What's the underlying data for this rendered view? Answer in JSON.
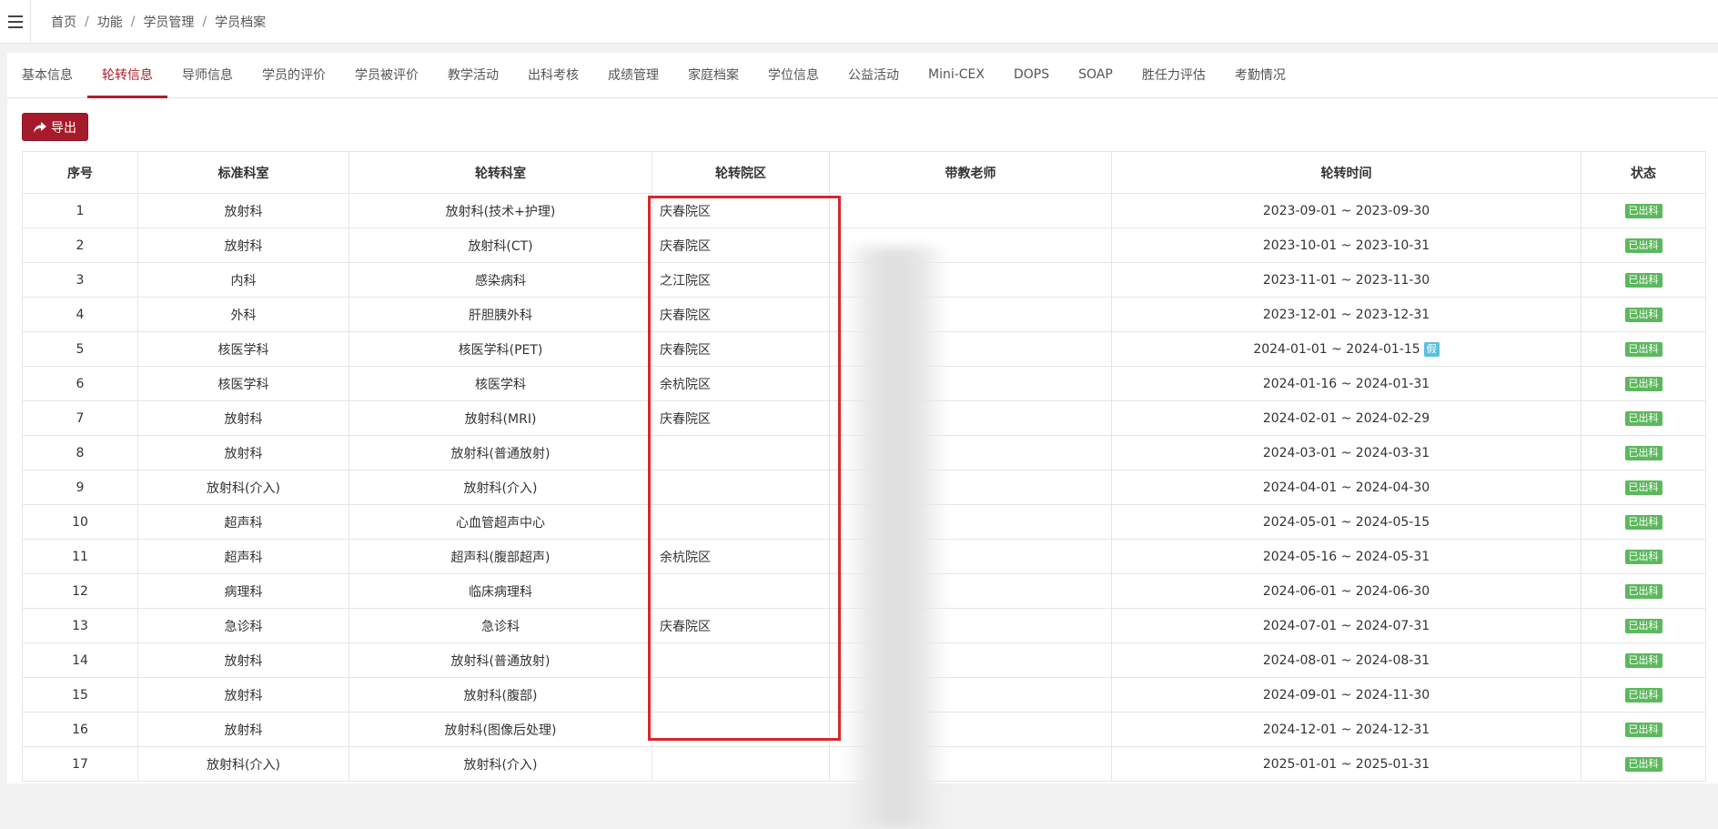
{
  "breadcrumb": [
    "首页",
    "功能",
    "学员管理",
    "学员档案"
  ],
  "tabs": [
    {
      "label": "基本信息",
      "active": false
    },
    {
      "label": "轮转信息",
      "active": true
    },
    {
      "label": "导师信息",
      "active": false
    },
    {
      "label": "学员的评价",
      "active": false
    },
    {
      "label": "学员被评价",
      "active": false
    },
    {
      "label": "教学活动",
      "active": false
    },
    {
      "label": "出科考核",
      "active": false
    },
    {
      "label": "成绩管理",
      "active": false
    },
    {
      "label": "家庭档案",
      "active": false
    },
    {
      "label": "学位信息",
      "active": false
    },
    {
      "label": "公益活动",
      "active": false
    },
    {
      "label": "Mini-CEX",
      "active": false
    },
    {
      "label": "DOPS",
      "active": false
    },
    {
      "label": "SOAP",
      "active": false
    },
    {
      "label": "胜任力评估",
      "active": false
    },
    {
      "label": "考勤情况",
      "active": false
    }
  ],
  "toolbar": {
    "export_label": "导出"
  },
  "table": {
    "headers": [
      "序号",
      "标准科室",
      "轮转科室",
      "轮转院区",
      "带教老师",
      "轮转时间",
      "状态"
    ],
    "rows": [
      {
        "no": "1",
        "std_dept": "放射科",
        "dept": "放射科(技术+护理)",
        "campus": "庆春院区",
        "teacher": "",
        "time": "2023-09-01 ~ 2023-09-30",
        "leave": "",
        "status": "已出科"
      },
      {
        "no": "2",
        "std_dept": "放射科",
        "dept": "放射科(CT)",
        "campus": "庆春院区",
        "teacher": "",
        "time": "2023-10-01 ~ 2023-10-31",
        "leave": "",
        "status": "已出科"
      },
      {
        "no": "3",
        "std_dept": "内科",
        "dept": "感染病科",
        "campus": "之江院区",
        "teacher": "",
        "time": "2023-11-01 ~ 2023-11-30",
        "leave": "",
        "status": "已出科"
      },
      {
        "no": "4",
        "std_dept": "外科",
        "dept": "肝胆胰外科",
        "campus": "庆春院区",
        "teacher": "",
        "time": "2023-12-01 ~ 2023-12-31",
        "leave": "",
        "status": "已出科"
      },
      {
        "no": "5",
        "std_dept": "核医学科",
        "dept": "核医学科(PET)",
        "campus": "庆春院区",
        "teacher": "",
        "time": "2024-01-01 ~ 2024-01-15",
        "leave": "假",
        "status": "已出科"
      },
      {
        "no": "6",
        "std_dept": "核医学科",
        "dept": "核医学科",
        "campus": "余杭院区",
        "teacher": "",
        "time": "2024-01-16 ~ 2024-01-31",
        "leave": "",
        "status": "已出科"
      },
      {
        "no": "7",
        "std_dept": "放射科",
        "dept": "放射科(MRI)",
        "campus": "庆春院区",
        "teacher": "",
        "time": "2024-02-01 ~ 2024-02-29",
        "leave": "",
        "status": "已出科"
      },
      {
        "no": "8",
        "std_dept": "放射科",
        "dept": "放射科(普通放射)",
        "campus": "",
        "teacher": "",
        "time": "2024-03-01 ~ 2024-03-31",
        "leave": "",
        "status": "已出科"
      },
      {
        "no": "9",
        "std_dept": "放射科(介入)",
        "dept": "放射科(介入)",
        "campus": "",
        "teacher": "",
        "time": "2024-04-01 ~ 2024-04-30",
        "leave": "",
        "status": "已出科"
      },
      {
        "no": "10",
        "std_dept": "超声科",
        "dept": "心血管超声中心",
        "campus": "",
        "teacher": "",
        "time": "2024-05-01 ~ 2024-05-15",
        "leave": "",
        "status": "已出科"
      },
      {
        "no": "11",
        "std_dept": "超声科",
        "dept": "超声科(腹部超声)",
        "campus": "余杭院区",
        "teacher": "",
        "time": "2024-05-16 ~ 2024-05-31",
        "leave": "",
        "status": "已出科"
      },
      {
        "no": "12",
        "std_dept": "病理科",
        "dept": "临床病理科",
        "campus": "",
        "teacher": "",
        "time": "2024-06-01 ~ 2024-06-30",
        "leave": "",
        "status": "已出科"
      },
      {
        "no": "13",
        "std_dept": "急诊科",
        "dept": "急诊科",
        "campus": "庆春院区",
        "teacher": "",
        "time": "2024-07-01 ~ 2024-07-31",
        "leave": "",
        "status": "已出科"
      },
      {
        "no": "14",
        "std_dept": "放射科",
        "dept": "放射科(普通放射)",
        "campus": "",
        "teacher": "",
        "time": "2024-08-01 ~ 2024-08-31",
        "leave": "",
        "status": "已出科"
      },
      {
        "no": "15",
        "std_dept": "放射科",
        "dept": "放射科(腹部)",
        "campus": "",
        "teacher": "",
        "time": "2024-09-01 ~ 2024-11-30",
        "leave": "",
        "status": "已出科"
      },
      {
        "no": "16",
        "std_dept": "放射科",
        "dept": "放射科(图像后处理)",
        "campus": "",
        "teacher": "",
        "time": "2024-12-01 ~ 2024-12-31",
        "leave": "",
        "status": "已出科"
      },
      {
        "no": "17",
        "std_dept": "放射科(介入)",
        "dept": "放射科(介入)",
        "campus": "",
        "teacher": "",
        "time": "2025-01-01 ~ 2025-01-31",
        "leave": "",
        "status": "已出科"
      }
    ]
  },
  "colors": {
    "accent": "#b01c2e",
    "status": "#5cb85c",
    "leave": "#5bc0de",
    "highlight": "#d8262c"
  }
}
